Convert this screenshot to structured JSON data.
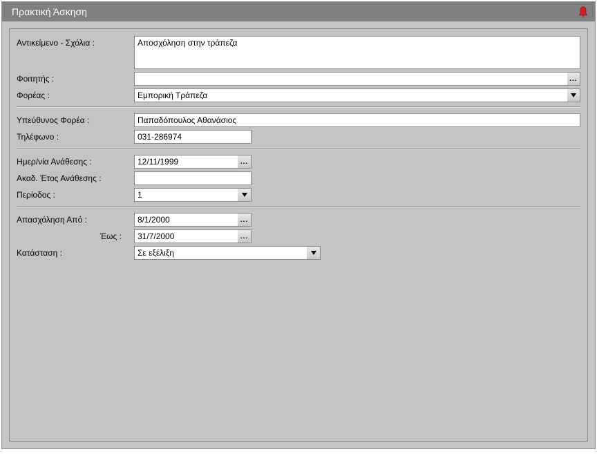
{
  "window": {
    "title": "Πρακτική Άσκηση"
  },
  "labels": {
    "subject": "Αντικείμενο - Σχόλια :",
    "student": "Φοιτητής :",
    "organization": "Φορέας :",
    "supervisor": "Υπεύθυνος Φορέα :",
    "phone": "Τηλέφωνο :",
    "assign_date": "Ημερ/νία Ανάθεσης :",
    "academic_year": "Ακαδ. Έτος Ανάθεσης :",
    "period": "Περίοδος :",
    "employ_from": "Απασχόληση   Από :",
    "employ_to": "Έως :",
    "status": "Κατάσταση :"
  },
  "values": {
    "subject": "Αποσχόληση στην τράπεζα",
    "student": "",
    "organization": "Εμπορική Τράπεζα",
    "supervisor": "Παπαδόπουλος Αθανάσιος",
    "phone": "031-286974",
    "assign_date": "12/11/1999",
    "academic_year": "",
    "period": "1",
    "employ_from": "8/1/2000",
    "employ_to": "31/7/2000",
    "status": "Σε εξέλιξη"
  }
}
